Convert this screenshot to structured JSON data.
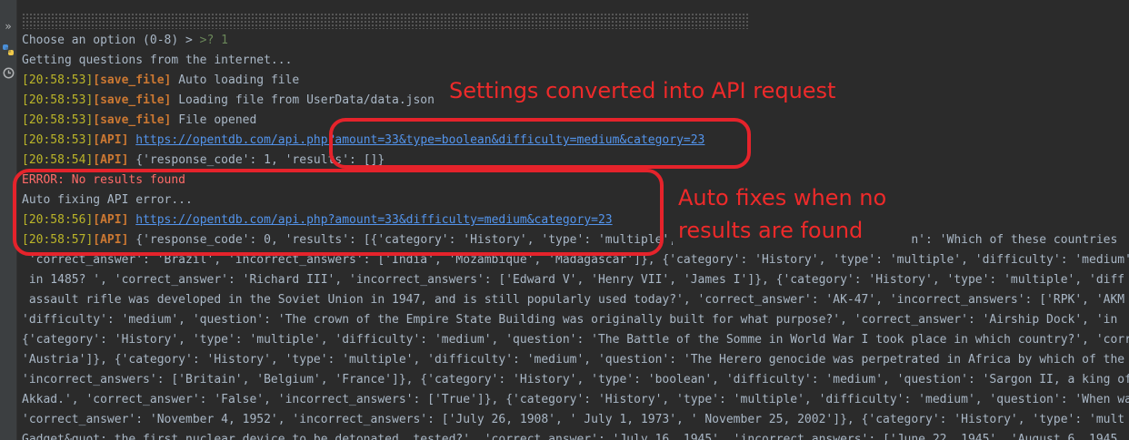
{
  "console": {
    "prompt": "Choose an option (0-8) > ",
    "prompt_marker": ">? ",
    "prompt_value": "1",
    "getting": "Getting questions from the internet...",
    "log1": {
      "ts": "[20:58:53]",
      "tag": "[save_file]",
      "msg": " Auto loading file"
    },
    "log2": {
      "ts": "[20:58:53]",
      "tag": "[save_file]",
      "msg": " Loading file from UserData/data.json"
    },
    "log3": {
      "ts": "[20:58:53]",
      "tag": "[save_file]",
      "msg": " File opened"
    },
    "log4": {
      "ts": "[20:58:53]",
      "tag": "[API]",
      "link": "https://opentdb.com/api.php?amount=33&type=boolean&difficulty=medium&category=23"
    },
    "log5": {
      "ts": "[20:58:54]",
      "tag": "[API]",
      "msg": " {'response_code': 1, 'results': []}"
    },
    "error": "ERROR: No results found",
    "autofix": "Auto fixing API error...",
    "log6": {
      "ts": "[20:58:56]",
      "tag": "[API]",
      "link": "https://opentdb.com/api.php?amount=33&difficulty=medium&category=23"
    },
    "log7": {
      "ts": "[20:58:57]",
      "tag": "[API]",
      "msg": " {'response_code': 0, 'results': [{'category': 'History', 'type': 'multiple', 'difficulty': 'medium', 'question': 'Which of these countries"
    },
    "cont": [
      " 'correct_answer': 'Brazil', 'incorrect_answers': ['India', 'Mozambique', 'Madagascar']}, {'category': 'History', 'type': 'multiple', 'difficulty': 'medium'",
      " in 1485? ', 'correct_answer': 'Richard III', 'incorrect_answers': ['Edward V', 'Henry VII', 'James I']}, {'category': 'History', 'type': 'multiple', 'diff",
      " assault rifle was developed in the Soviet Union in 1947, and is still popularly used today?', 'correct_answer': 'AK-47', 'incorrect_answers': ['RPK', 'AKM",
      "'difficulty': 'medium', 'question': 'The crown of the Empire State Building was originally built for what purpose?', 'correct_answer': 'Airship Dock', 'in",
      "{'category': 'History', 'type': 'multiple', 'difficulty': 'medium', 'question': 'The Battle of the Somme in World War I took place in which country?', 'corr",
      "'Austria']}, {'category': 'History', 'type': 'multiple', 'difficulty': 'medium', 'question': 'The Herero genocide was perpetrated in Africa by which of the",
      "'incorrect_answers': ['Britain', 'Belgium', 'France']}, {'category': 'History', 'type': 'boolean', 'difficulty': 'medium', 'question': 'Sargon II, a king of",
      "Akkad.', 'correct_answer': 'False', 'incorrect_answers': ['True']}, {'category': 'History', 'type': 'multiple', 'difficulty': 'medium', 'question': 'When wa",
      "'correct_answer': 'November 4, 1952', 'incorrect_answers': ['July 26, 1908', ' July 1, 1973', ' November 25, 2002']}, {'category': 'History', 'type': 'mult",
      "Gadget&quot; the first nuclear device to be detonated, tested?', 'correct_answer': 'July 16, 1945', 'incorrect_answers': ['June 22, 1945', 'August 6, 1945"
    ]
  },
  "annotations": {
    "settings": "Settings converted into API request",
    "autofix_line1": "Auto fixes when no",
    "autofix_line2": "results are found"
  },
  "colors": {
    "annotation": "#e5232b",
    "background": "#2b2b2b"
  },
  "icons": [
    "run-step-icon",
    "python-console-icon",
    "history-icon"
  ]
}
